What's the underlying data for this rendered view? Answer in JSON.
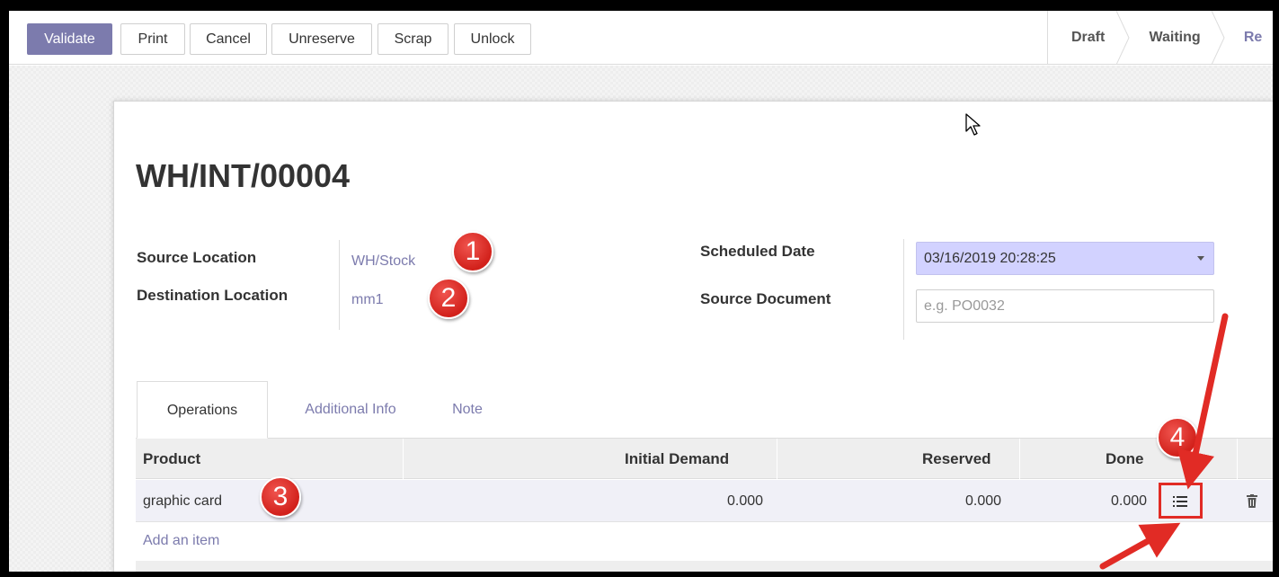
{
  "toolbar": {
    "validate": "Validate",
    "print": "Print",
    "cancel": "Cancel",
    "unreserve": "Unreserve",
    "scrap": "Scrap",
    "unlock": "Unlock"
  },
  "statusbar": {
    "draft": "Draft",
    "waiting": "Waiting",
    "ready": "Re"
  },
  "record": {
    "title": "WH/INT/00004",
    "source_location_label": "Source Location",
    "source_location_value": "WH/Stock",
    "destination_location_label": "Destination Location",
    "destination_location_value": "mm1",
    "scheduled_date_label": "Scheduled Date",
    "scheduled_date_value": "03/16/2019 20:28:25",
    "source_document_label": "Source Document",
    "source_document_placeholder": "e.g. PO0032"
  },
  "tabs": {
    "operations": "Operations",
    "additional_info": "Additional Info",
    "note": "Note"
  },
  "table": {
    "headers": {
      "product": "Product",
      "initial_demand": "Initial Demand",
      "reserved": "Reserved",
      "done": "Done"
    },
    "rows": [
      {
        "product": "graphic card",
        "initial_demand": "0.000",
        "reserved": "0.000",
        "done": "0.000"
      }
    ],
    "add_item": "Add an item"
  },
  "annotations": {
    "b1": "1",
    "b2": "2",
    "b3": "3",
    "b4": "4"
  },
  "colors": {
    "accent": "#7c7bad",
    "date_field": "#d2d2ff",
    "annotation_red": "#e12b25"
  }
}
